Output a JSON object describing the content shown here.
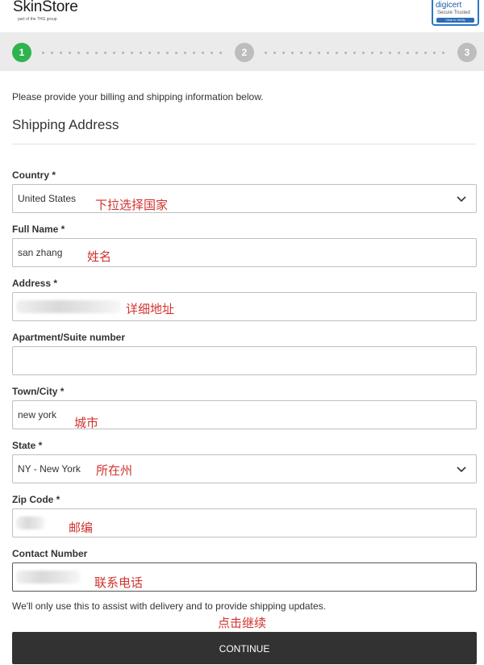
{
  "header": {
    "logo": "SkinStore",
    "logo_sub": "part of the THG group",
    "badge": {
      "title": "digicert",
      "line": "Secure Trusted",
      "button": "Click to Verify"
    }
  },
  "progress": {
    "steps": [
      "1",
      "2",
      "3"
    ],
    "active_step": 1,
    "active_color": "#2fb350"
  },
  "form": {
    "intro": "Please provide your billing and shipping information below.",
    "section_title": "Shipping Address",
    "country": {
      "label": "Country *",
      "value": "United States",
      "note": "下拉选择国家"
    },
    "full_name": {
      "label": "Full Name *",
      "value": "san zhang",
      "note": "姓名"
    },
    "address": {
      "label": "Address *",
      "value": "",
      "note": "详细地址"
    },
    "apartment": {
      "label": "Apartment/Suite number",
      "value": ""
    },
    "town": {
      "label": "Town/City *",
      "value": "new york",
      "note": "城市"
    },
    "state": {
      "label": "State *",
      "value": "NY - New York",
      "note": "所在州"
    },
    "zip": {
      "label": "Zip Code *",
      "value": "",
      "note": "邮编"
    },
    "contact": {
      "label": "Contact Number",
      "value": "",
      "note": "联系电话"
    },
    "help_text": "We'll only use this to assist with delivery and to provide shipping updates.",
    "continue_note": "点击继续",
    "continue_label": "CONTINUE"
  },
  "colors": {
    "annotation": "#d0332f",
    "button": "#323232"
  }
}
